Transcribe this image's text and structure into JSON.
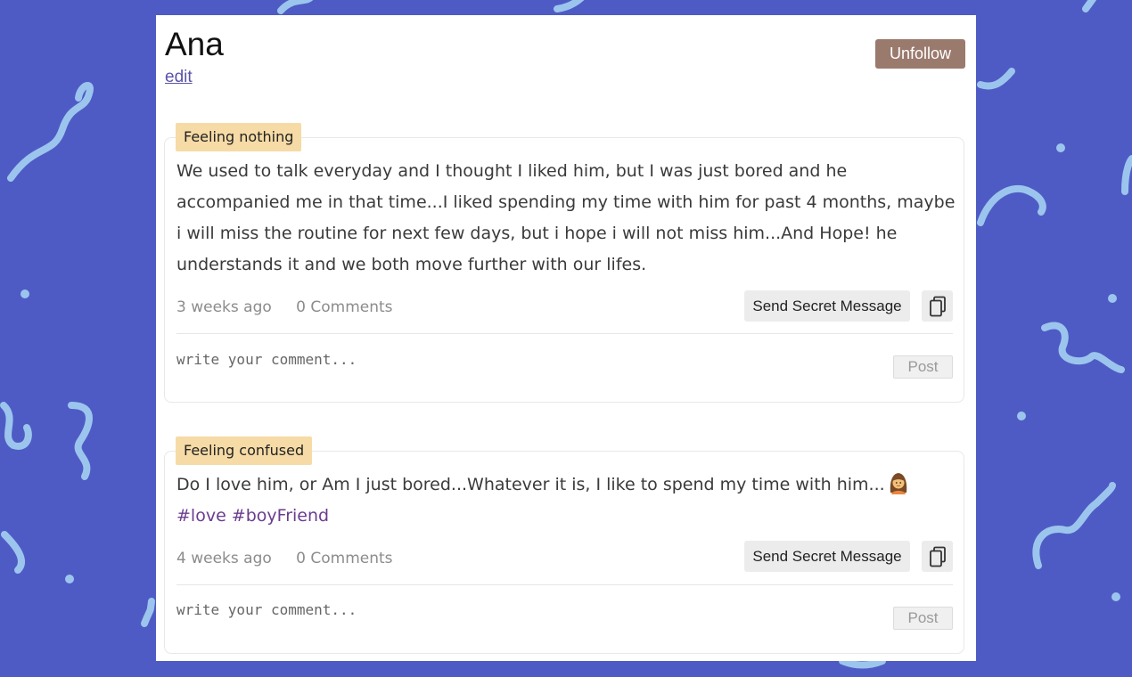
{
  "profile": {
    "name": "Ana",
    "edit_label": "edit",
    "unfollow_label": "Unfollow"
  },
  "posts": [
    {
      "feeling": "Feeling nothing",
      "body": "We used to talk everyday and I thought I liked him, but I was just bored and he accompanied me in that time...I liked spending my time with him for past 4 months, maybe i will miss the routine for next few days, but i hope i will not miss him...And Hope! he understands it and we both move further with our lifes.",
      "time": "3 weeks ago",
      "comments": "0 Comments",
      "secret_label": "Send Secret Message",
      "copy_icon": "copy-icon",
      "comment_placeholder": "write your comment...",
      "post_label": "Post"
    },
    {
      "feeling": "Feeling confused",
      "body": "Do I love him, or Am I just bored...Whatever it is, I like to spend my time with him...",
      "emoji": "woman-emoji",
      "hashtags": "#love #boyFriend",
      "time": "4 weeks ago",
      "comments": "0 Comments",
      "secret_label": "Send Secret Message",
      "copy_icon": "copy-icon",
      "comment_placeholder": "write your comment...",
      "post_label": "Post"
    }
  ],
  "colors": {
    "background": "#4f5bc4",
    "decoration": "#9cc5ee",
    "feeling_tag": "#f6dba6",
    "unfollow": "#9b7a6e",
    "hashtag": "#6a3d8f",
    "link": "#5b53a8"
  }
}
